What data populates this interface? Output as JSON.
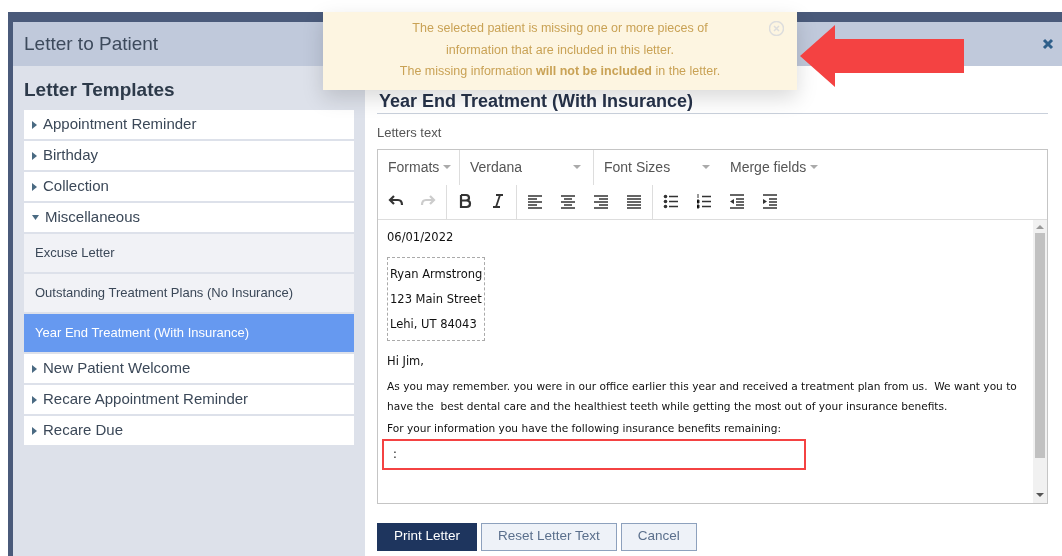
{
  "window": {
    "title": "Letter to Patient"
  },
  "templates": {
    "heading": "Letter Templates",
    "groups": [
      {
        "label": "Appointment Reminder",
        "expanded": false
      },
      {
        "label": "Birthday",
        "expanded": false
      },
      {
        "label": "Collection",
        "expanded": false
      },
      {
        "label": "Miscellaneous",
        "expanded": true,
        "children": [
          {
            "label": "Excuse Letter",
            "selected": false
          },
          {
            "label": "Outstanding Treatment Plans (No Insurance)",
            "selected": false
          },
          {
            "label": "Year End Treatment (With Insurance)",
            "selected": true
          }
        ]
      },
      {
        "label": "New Patient Welcome",
        "expanded": false
      },
      {
        "label": "Recare Appointment Reminder",
        "expanded": false
      },
      {
        "label": "Recare Due",
        "expanded": false
      }
    ]
  },
  "letter": {
    "heading": "Year End Treatment (With Insurance)",
    "field_label": "Letters text",
    "toolbar": {
      "dropdowns": [
        "Formats",
        "Verdana",
        "Font Sizes",
        "Merge fields"
      ],
      "redo_disabled": true
    },
    "content": {
      "date": "06/01/2022",
      "address": [
        "Ryan Armstrong",
        "123 Main Street",
        "Lehi, UT 84043"
      ],
      "greeting": "Hi Jim,",
      "paragraphs": [
        "As you may remember. you were in our office earlier this year and received a treatment plan from us.  We want you to have the  best dental care and the healthiest teeth while getting the most out of your insurance benefits.",
        "For your information you have the following insurance benefits remaining:"
      ],
      "highlighted_line": ":"
    }
  },
  "buttons": [
    {
      "label": "Print Letter",
      "kind": "primary"
    },
    {
      "label": "Reset Letter Text",
      "kind": "secondary"
    },
    {
      "label": "Cancel",
      "kind": "secondary"
    }
  ],
  "notification": {
    "lines": [
      "The selected patient is missing one or more pieces of",
      "information that are included in this letter.",
      "The missing information **will not be included** in the letter."
    ]
  }
}
